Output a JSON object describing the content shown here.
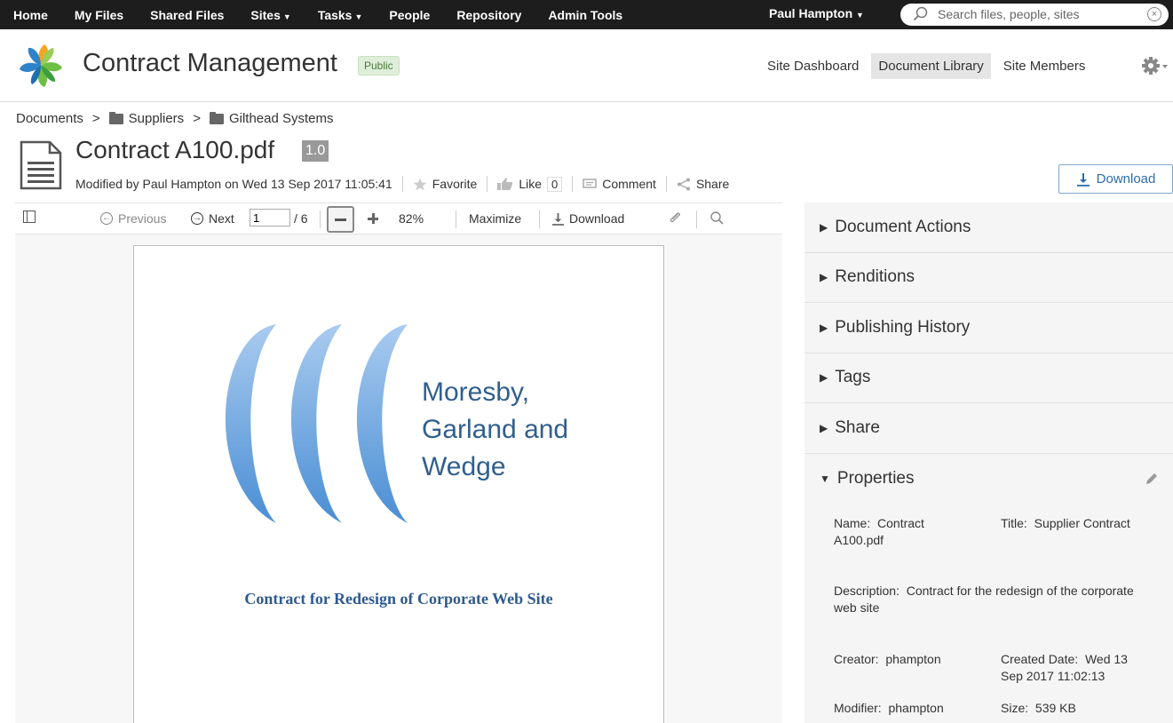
{
  "topnav": {
    "items": [
      "Home",
      "My Files",
      "Shared Files",
      "Sites",
      "Tasks",
      "People",
      "Repository",
      "Admin Tools"
    ],
    "user": "Paul Hampton",
    "search_placeholder": "Search files, people, sites"
  },
  "site": {
    "title": "Contract Management",
    "visibility": "Public",
    "nav": [
      "Site Dashboard",
      "Document Library",
      "Site Members"
    ]
  },
  "breadcrumb": {
    "root": "Documents",
    "folders": [
      "Suppliers",
      "Gilthead Systems"
    ]
  },
  "document": {
    "title": "Contract A100.pdf",
    "version": "1.0",
    "modified_prefix": "Modified by",
    "modified_by": "Paul Hampton",
    "modified_on_prefix": "on",
    "modified_date": "Wed 13 Sep 2017 11:05:41",
    "favorite_label": "Favorite",
    "like_label": "Like",
    "like_count": "0",
    "comment_label": "Comment",
    "share_label": "Share",
    "download_label": "Download"
  },
  "viewer_toolbar": {
    "previous": "Previous",
    "next": "Next",
    "page_value": "1",
    "page_total": "/ 6",
    "zoom": "82%",
    "maximize": "Maximize",
    "download": "Download"
  },
  "pdf_page": {
    "company_lines": [
      "Moresby,",
      "Garland and",
      "Wedge"
    ],
    "subtitle": "Contract for Redesign of Corporate Web Site"
  },
  "panel": {
    "sections": [
      "Document Actions",
      "Renditions",
      "Publishing History",
      "Tags",
      "Share"
    ],
    "properties_title": "Properties",
    "properties": {
      "name_label": "Name:",
      "name_value": "Contract A100.pdf",
      "title_label": "Title:",
      "title_value": "Supplier Contract",
      "description_label": "Description:",
      "description_value": "Contract for the redesign of the corporate web site",
      "creator_label": "Creator:",
      "creator_value": "phampton",
      "created_label": "Created Date:",
      "created_value": "Wed 13 Sep 2017 11:02:13",
      "modifier_label": "Modifier:",
      "modifier_value": "phampton",
      "size_label": "Size:",
      "size_value": "539 KB"
    }
  },
  "colors": {
    "topbar": "#1d1d1d",
    "accent": "#2a6db0",
    "logo_blue": "#2f83c8",
    "logo_green": "#6fbe44",
    "logo_orange": "#f5a623"
  }
}
